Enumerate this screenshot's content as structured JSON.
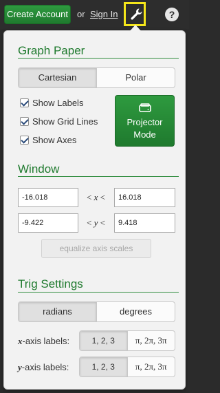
{
  "topbar": {
    "create_account": "Create Account",
    "or": "or",
    "sign_in": "Sign In",
    "help": "?"
  },
  "graph_paper": {
    "title": "Graph Paper",
    "modes": [
      "Cartesian",
      "Polar"
    ],
    "selected_mode": "Cartesian",
    "checkboxes": [
      {
        "label": "Show Labels",
        "checked": true
      },
      {
        "label": "Show Grid Lines",
        "checked": true
      },
      {
        "label": "Show Axes",
        "checked": true
      }
    ],
    "projector_line1": "Projector",
    "projector_line2": "Mode"
  },
  "window": {
    "title": "Window",
    "x_min": "-16.018",
    "x_max": "16.018",
    "y_min": "-9.422",
    "y_max": "9.418",
    "x_ineq_lt1": "<",
    "x_var": "x",
    "x_ineq_lt2": "<",
    "y_ineq_lt1": "<",
    "y_var": "y",
    "y_ineq_lt2": "<",
    "equalize": "equalize axis scales"
  },
  "trig": {
    "title": "Trig Settings",
    "modes": [
      "radians",
      "degrees"
    ],
    "selected_mode": "radians",
    "x_axis_var": "x",
    "x_axis_suffix": "-axis labels:",
    "y_axis_var": "y",
    "y_axis_suffix": "-axis labels:",
    "label_options": [
      "1, 2, 3",
      "π, 2π, 3π"
    ],
    "x_selected": "1, 2, 3",
    "y_selected": "1, 2, 3"
  },
  "colors": {
    "accent_green": "#1f7a2e",
    "highlight_yellow": "#f5e61a"
  },
  "icons": {
    "settings": "wrench-icon",
    "projector": "projector-icon",
    "help": "question-icon"
  }
}
